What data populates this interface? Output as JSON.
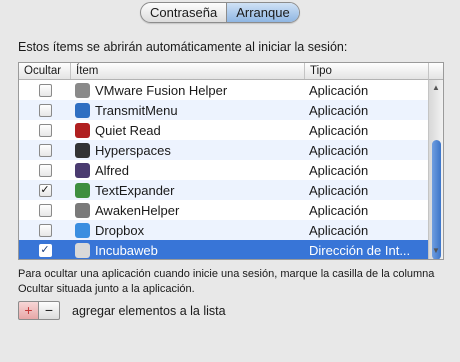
{
  "tabs": [
    {
      "label": "Contraseña",
      "active": false
    },
    {
      "label": "Arranque",
      "active": true
    }
  ],
  "intro_text": "Estos ítems se abrirán automáticamente al iniciar la sesión:",
  "table": {
    "headers": {
      "hide": "Ocultar",
      "item": "Ítem",
      "type": "Tipo"
    },
    "rows": [
      {
        "name": "VMware Fusion Helper",
        "type": "Aplicación",
        "hidden": false,
        "icon": "vmware-icon",
        "color": "#8a8a8a",
        "selected": false
      },
      {
        "name": "TransmitMenu",
        "type": "Aplicación",
        "hidden": false,
        "icon": "transmit-icon",
        "color": "#2f6fc2",
        "selected": false
      },
      {
        "name": "Quiet Read",
        "type": "Aplicación",
        "hidden": false,
        "icon": "quietread-icon",
        "color": "#b02020",
        "selected": false
      },
      {
        "name": "Hyperspaces",
        "type": "Aplicación",
        "hidden": false,
        "icon": "hyperspaces-icon",
        "color": "#333333",
        "selected": false
      },
      {
        "name": "Alfred",
        "type": "Aplicación",
        "hidden": false,
        "icon": "alfred-icon",
        "color": "#4a3b70",
        "selected": false
      },
      {
        "name": "TextExpander",
        "type": "Aplicación",
        "hidden": true,
        "icon": "textexpander-icon",
        "color": "#3f8f3f",
        "selected": false
      },
      {
        "name": "AwakenHelper",
        "type": "Aplicación",
        "hidden": false,
        "icon": "awaken-icon",
        "color": "#7a7a7a",
        "selected": false
      },
      {
        "name": "Dropbox",
        "type": "Aplicación",
        "hidden": false,
        "icon": "dropbox-icon",
        "color": "#3b8ee0",
        "selected": false
      },
      {
        "name": "Incubaweb",
        "type": "Dirección de Int...",
        "hidden": true,
        "icon": "webloc-icon",
        "color": "#d9d9d9",
        "selected": true
      }
    ]
  },
  "help_text": "Para ocultar una aplicación cuando inicie una sesión, marque la casilla de la columna Ocultar situada junto a la aplicación.",
  "buttons": {
    "add": "+",
    "remove": "−"
  },
  "add_label": "agregar elementos a la lista",
  "check_glyph": "✓"
}
